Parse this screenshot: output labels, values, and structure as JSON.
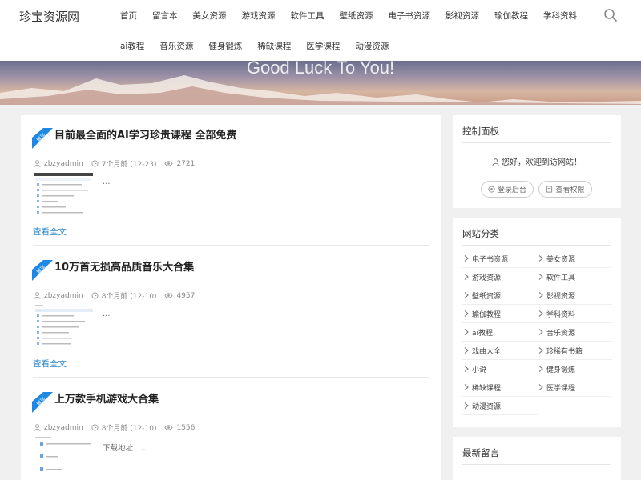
{
  "header": {
    "logo": "珍宝资源网",
    "nav_row1": [
      "首页",
      "留言本",
      "美女资源",
      "游戏资源",
      "软件工具",
      "壁纸资源",
      "电子书资源",
      "影视资源",
      "瑜伽教程",
      "学科资料"
    ],
    "nav_row2": [
      "ai教程",
      "音乐资源",
      "健身锻炼",
      "稀缺课程",
      "医学课程",
      "动漫资源"
    ]
  },
  "banner": {
    "text": "Good Luck To You!"
  },
  "posts": [
    {
      "badge": "置顶",
      "title": "目前最全面的AI学习珍贵课程 全部免费",
      "author": "zbzyadmin",
      "time": "7个月前 (12-23)",
      "views": "2721",
      "excerpt": "…",
      "readmore": "查看全文"
    },
    {
      "badge": "置顶",
      "title": "10万首无损高品质音乐大合集",
      "author": "zbzyadmin",
      "time": "8个月前 (12-10)",
      "views": "4957",
      "excerpt": "…",
      "readmore": "查看全文"
    },
    {
      "badge": "置顶",
      "title": "上万款手机游戏大合集",
      "author": "zbzyadmin",
      "time": "8个月前 (12-10)",
      "views": "1556",
      "excerpt": "下载地址：…",
      "readmore": "查看全文"
    }
  ],
  "sidebar": {
    "control_panel": {
      "title": "控制面板",
      "welcome": "您好，欢迎到访网站！",
      "login": "登录后台",
      "permissions": "查看权限"
    },
    "categories": {
      "title": "网站分类",
      "items": [
        "电子书资源",
        "美女资源",
        "游戏资源",
        "软件工具",
        "壁纸资源",
        "影视资源",
        "瑜伽教程",
        "学科资料",
        "ai教程",
        "音乐资源",
        "戏曲大全",
        "珍稀有书籍",
        "小说",
        "健身锻炼",
        "稀缺课程",
        "医学课程",
        "动漫资源"
      ]
    },
    "latest_comments": {
      "title": "最新留言"
    }
  },
  "colors": {
    "accent": "#2a86c8",
    "ribbon": "#1e88e5",
    "background": "#f0f0f0"
  }
}
